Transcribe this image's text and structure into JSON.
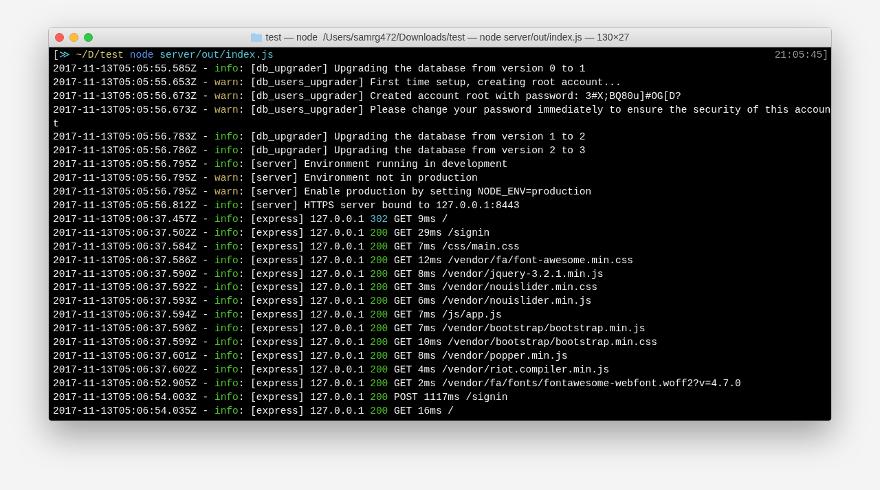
{
  "window": {
    "title": "test — node  /Users/samrg472/Downloads/test — node server/out/index.js — 130×27"
  },
  "prompt": {
    "segments": [
      {
        "text": "[",
        "color": "#c8c8c8"
      },
      {
        "text": "≫",
        "color": "#5fc3d6"
      },
      {
        "text": "~/D/test",
        "color": "#d8c97a"
      },
      {
        "text": "node",
        "color": "#5b8fe8"
      },
      {
        "text": "server/out/index.js",
        "color": "#5fc3d6"
      }
    ],
    "time": "21:05:45]"
  },
  "lines": [
    {
      "kind": "log",
      "prefix": "2017-11-13T05:05:55.585Z - ",
      "level": "info",
      "message": ": [db_upgrader] Upgrading the database from version 0 to 1"
    },
    {
      "kind": "log",
      "prefix": "2017-11-13T05:05:55.653Z - ",
      "level": "warn",
      "message": ": [db_users_upgrader] First time setup, creating root account..."
    },
    {
      "kind": "log",
      "prefix": "2017-11-13T05:05:56.673Z - ",
      "level": "warn",
      "message": ": [db_users_upgrader] Created account root with password: 3#X;BQ80u]#OG[D?"
    },
    {
      "kind": "log",
      "prefix": "2017-11-13T05:05:56.673Z - ",
      "level": "warn",
      "message": ": [db_users_upgrader] Please change your password immediately to ensure the security of this accoun"
    },
    {
      "kind": "continuation",
      "text": "t"
    },
    {
      "kind": "log",
      "prefix": "2017-11-13T05:05:56.783Z - ",
      "level": "info",
      "message": ": [db_upgrader] Upgrading the database from version 1 to 2"
    },
    {
      "kind": "log",
      "prefix": "2017-11-13T05:05:56.786Z - ",
      "level": "info",
      "message": ": [db_upgrader] Upgrading the database from version 2 to 3"
    },
    {
      "kind": "log",
      "prefix": "2017-11-13T05:05:56.795Z - ",
      "level": "info",
      "message": ": [server] Environment running in development"
    },
    {
      "kind": "log",
      "prefix": "2017-11-13T05:05:56.795Z - ",
      "level": "warn",
      "message": ": [server] Environment not in production"
    },
    {
      "kind": "log",
      "prefix": "2017-11-13T05:05:56.795Z - ",
      "level": "warn",
      "message": ": [server] Enable production by setting NODE_ENV=production"
    },
    {
      "kind": "log",
      "prefix": "2017-11-13T05:05:56.812Z - ",
      "level": "info",
      "message": ": [server] HTTPS server bound to 127.0.0.1:8443"
    },
    {
      "kind": "request",
      "prefix": "2017-11-13T05:06:37.457Z - ",
      "level": "info",
      "message": ": [express] 127.0.0.1 ",
      "status": "302",
      "color": "#5fc3d6",
      "request": " GET 9ms /"
    },
    {
      "kind": "request",
      "prefix": "2017-11-13T05:06:37.502Z - ",
      "level": "info",
      "message": ": [express] 127.0.0.1 ",
      "status": "200",
      "color": "#4ec42c",
      "request": " GET 29ms /signin"
    },
    {
      "kind": "request",
      "prefix": "2017-11-13T05:06:37.584Z - ",
      "level": "info",
      "message": ": [express] 127.0.0.1 ",
      "status": "200",
      "color": "#4ec42c",
      "request": " GET 7ms /css/main.css"
    },
    {
      "kind": "request",
      "prefix": "2017-11-13T05:06:37.586Z - ",
      "level": "info",
      "message": ": [express] 127.0.0.1 ",
      "status": "200",
      "color": "#4ec42c",
      "request": " GET 12ms /vendor/fa/font-awesome.min.css"
    },
    {
      "kind": "request",
      "prefix": "2017-11-13T05:06:37.590Z - ",
      "level": "info",
      "message": ": [express] 127.0.0.1 ",
      "status": "200",
      "color": "#4ec42c",
      "request": " GET 8ms /vendor/jquery-3.2.1.min.js"
    },
    {
      "kind": "request",
      "prefix": "2017-11-13T05:06:37.592Z - ",
      "level": "info",
      "message": ": [express] 127.0.0.1 ",
      "status": "200",
      "color": "#4ec42c",
      "request": " GET 3ms /vendor/nouislider.min.css"
    },
    {
      "kind": "request",
      "prefix": "2017-11-13T05:06:37.593Z - ",
      "level": "info",
      "message": ": [express] 127.0.0.1 ",
      "status": "200",
      "color": "#4ec42c",
      "request": " GET 6ms /vendor/nouislider.min.js"
    },
    {
      "kind": "request",
      "prefix": "2017-11-13T05:06:37.594Z - ",
      "level": "info",
      "message": ": [express] 127.0.0.1 ",
      "status": "200",
      "color": "#4ec42c",
      "request": " GET 7ms /js/app.js"
    },
    {
      "kind": "request",
      "prefix": "2017-11-13T05:06:37.596Z - ",
      "level": "info",
      "message": ": [express] 127.0.0.1 ",
      "status": "200",
      "color": "#4ec42c",
      "request": " GET 7ms /vendor/bootstrap/bootstrap.min.js"
    },
    {
      "kind": "request",
      "prefix": "2017-11-13T05:06:37.599Z - ",
      "level": "info",
      "message": ": [express] 127.0.0.1 ",
      "status": "200",
      "color": "#4ec42c",
      "request": " GET 10ms /vendor/bootstrap/bootstrap.min.css"
    },
    {
      "kind": "request",
      "prefix": "2017-11-13T05:06:37.601Z - ",
      "level": "info",
      "message": ": [express] 127.0.0.1 ",
      "status": "200",
      "color": "#4ec42c",
      "request": " GET 8ms /vendor/popper.min.js"
    },
    {
      "kind": "request",
      "prefix": "2017-11-13T05:06:37.602Z - ",
      "level": "info",
      "message": ": [express] 127.0.0.1 ",
      "status": "200",
      "color": "#4ec42c",
      "request": " GET 4ms /vendor/riot.compiler.min.js"
    },
    {
      "kind": "request",
      "prefix": "2017-11-13T05:06:52.905Z - ",
      "level": "info",
      "message": ": [express] 127.0.0.1 ",
      "status": "200",
      "color": "#4ec42c",
      "request": " GET 2ms /vendor/fa/fonts/fontawesome-webfont.woff2?v=4.7.0"
    },
    {
      "kind": "request",
      "prefix": "2017-11-13T05:06:54.003Z - ",
      "level": "info",
      "message": ": [express] 127.0.0.1 ",
      "status": "200",
      "color": "#4ec42c",
      "request": " POST 1117ms /signin"
    },
    {
      "kind": "request",
      "prefix": "2017-11-13T05:06:54.035Z - ",
      "level": "info",
      "message": ": [express] 127.0.0.1 ",
      "status": "200",
      "color": "#4ec42c",
      "request": " GET 16ms /"
    }
  ]
}
